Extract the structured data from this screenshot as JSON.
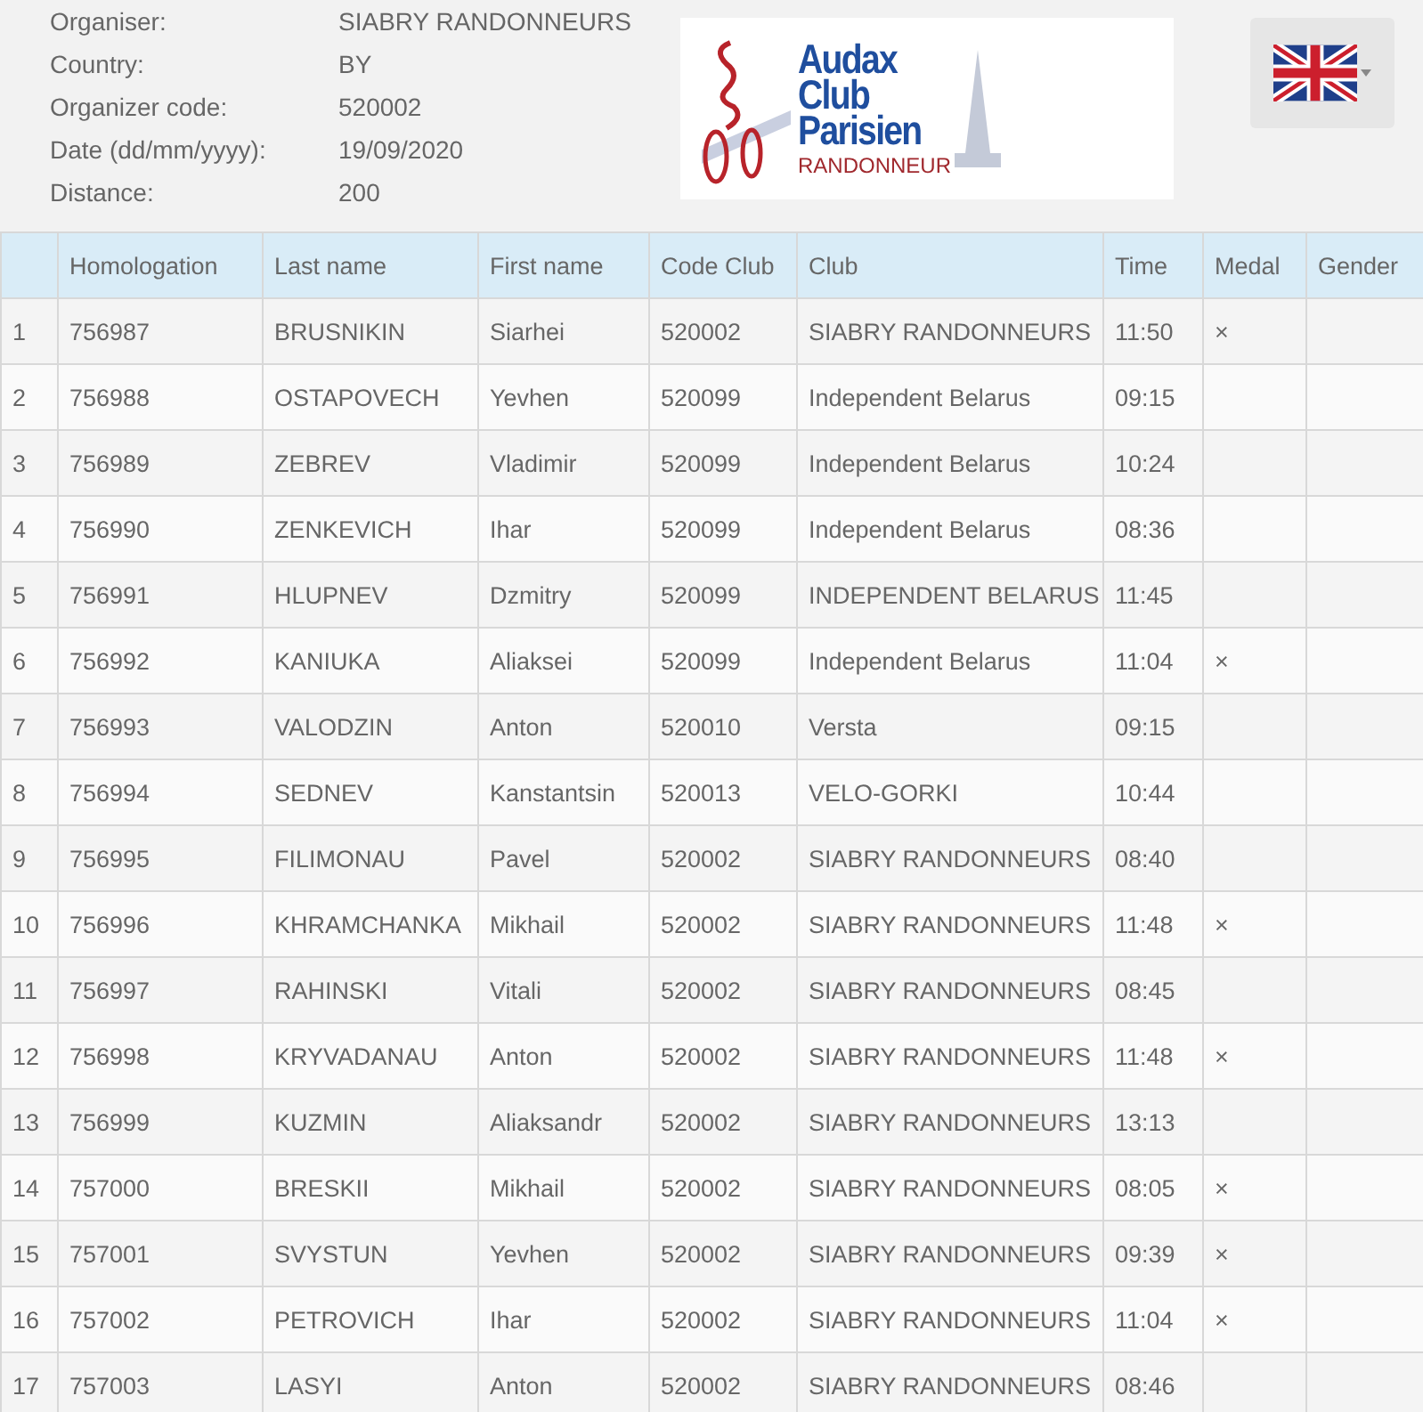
{
  "event_info": [
    {
      "label": "Organiser:",
      "value": "SIABRY RANDONNEURS"
    },
    {
      "label": "Country:",
      "value": "BY"
    },
    {
      "label": "Organizer code:",
      "value": "520002"
    },
    {
      "label": "Date (dd/mm/yyyy):",
      "value": "19/09/2020"
    },
    {
      "label": "Distance:",
      "value": "200"
    }
  ],
  "logo": {
    "title_lines": [
      "Audax",
      "Club",
      "Parisien"
    ],
    "subtitle": "RANDONNEUR"
  },
  "table": {
    "columns": [
      "Homologation",
      "Last name",
      "First name",
      "Code Club",
      "Club",
      "Time",
      "Medal",
      "Gender"
    ],
    "rows": [
      {
        "number": "1",
        "homologation": "756987",
        "last_name": "BRUSNIKIN",
        "first_name": "Siarhei",
        "code_club": "520002",
        "club": "SIABRY RANDONNEURS",
        "time": "11:50",
        "medal": "×"
      },
      {
        "number": "2",
        "homologation": "756988",
        "last_name": "OSTAPOVECH",
        "first_name": "Yevhen",
        "code_club": "520099",
        "club": "Independent Belarus",
        "time": "09:15"
      },
      {
        "number": "3",
        "homologation": "756989",
        "last_name": "ZEBREV",
        "first_name": "Vladimir",
        "code_club": "520099",
        "club": "Independent Belarus",
        "time": "10:24"
      },
      {
        "number": "4",
        "homologation": "756990",
        "last_name": "ZENKEVICH",
        "first_name": "Ihar",
        "code_club": "520099",
        "club": "Independent Belarus",
        "time": "08:36"
      },
      {
        "number": "5",
        "homologation": "756991",
        "last_name": "HLUPNEV",
        "first_name": "Dzmitry",
        "code_club": "520099",
        "club": "INDEPENDENT BELARUS",
        "time": "11:45"
      },
      {
        "number": "6",
        "homologation": "756992",
        "last_name": "KANIUKA",
        "first_name": "Aliaksei",
        "code_club": "520099",
        "club": "Independent Belarus",
        "time": "11:04",
        "medal": "×"
      },
      {
        "number": "7",
        "homologation": "756993",
        "last_name": "VALODZIN",
        "first_name": "Anton",
        "code_club": "520010",
        "club": "Versta",
        "time": "09:15"
      },
      {
        "number": "8",
        "homologation": "756994",
        "last_name": "SEDNEV",
        "first_name": "Kanstantsin",
        "code_club": "520013",
        "club": "VELO-GORKI",
        "time": "10:44"
      },
      {
        "number": "9",
        "homologation": "756995",
        "last_name": "FILIMONAU",
        "first_name": "Pavel",
        "code_club": "520002",
        "club": "SIABRY RANDONNEURS",
        "time": "08:40"
      },
      {
        "number": "10",
        "homologation": "756996",
        "last_name": "KHRAMCHANKA",
        "first_name": "Mikhail",
        "code_club": "520002",
        "club": "SIABRY RANDONNEURS",
        "time": "11:48",
        "medal": "×"
      },
      {
        "number": "11",
        "homologation": "756997",
        "last_name": "RAHINSKI",
        "first_name": "Vitali",
        "code_club": "520002",
        "club": "SIABRY RANDONNEURS",
        "time": "08:45"
      },
      {
        "number": "12",
        "homologation": "756998",
        "last_name": "KRYVADANAU",
        "first_name": "Anton",
        "code_club": "520002",
        "club": "SIABRY RANDONNEURS",
        "time": "11:48",
        "medal": "×"
      },
      {
        "number": "13",
        "homologation": "756999",
        "last_name": "KUZMIN",
        "first_name": "Aliaksandr",
        "code_club": "520002",
        "club": "SIABRY RANDONNEURS",
        "time": "13:13"
      },
      {
        "number": "14",
        "homologation": "757000",
        "last_name": "BRESKII",
        "first_name": "Mikhail",
        "code_club": "520002",
        "club": "SIABRY RANDONNEURS",
        "time": "08:05",
        "medal": "×"
      },
      {
        "number": "15",
        "homologation": "757001",
        "last_name": "SVYSTUN",
        "first_name": "Yevhen",
        "code_club": "520002",
        "club": "SIABRY RANDONNEURS",
        "time": "09:39",
        "medal": "×"
      },
      {
        "number": "16",
        "homologation": "757002",
        "last_name": "PETROVICH",
        "first_name": "Ihar",
        "code_club": "520002",
        "club": "SIABRY RANDONNEURS",
        "time": "11:04",
        "medal": "×"
      },
      {
        "number": "17",
        "homologation": "757003",
        "last_name": "LASYI",
        "first_name": "Anton",
        "code_club": "520002",
        "club": "SIABRY RANDONNEURS",
        "time": "08:46"
      }
    ]
  }
}
